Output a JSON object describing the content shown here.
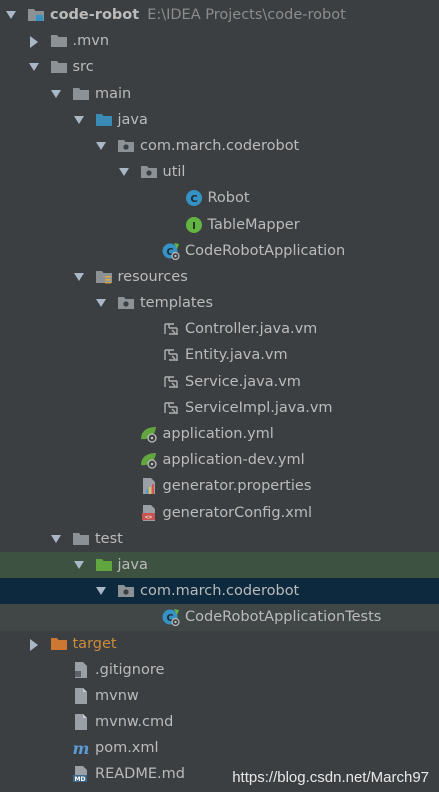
{
  "project": {
    "name": "code-robot",
    "path": "E:\\IDEA Projects\\code-robot"
  },
  "tree": [
    {
      "label": "code-robot",
      "extra": "E:\\IDEA Projects\\code-robot",
      "level": 0,
      "arrow": "down",
      "icon": "module-folder-icon",
      "name": "tree-item-code-robot"
    },
    {
      "label": ".mvn",
      "level": 1,
      "arrow": "right",
      "icon": "folder-icon",
      "name": "tree-item-mvn"
    },
    {
      "label": "src",
      "level": 1,
      "arrow": "down",
      "icon": "folder-icon",
      "name": "tree-item-src"
    },
    {
      "label": "main",
      "level": 2,
      "arrow": "down",
      "icon": "folder-icon",
      "name": "tree-item-main"
    },
    {
      "label": "java",
      "level": 3,
      "arrow": "down",
      "icon": "source-folder-icon",
      "name": "tree-item-main-java"
    },
    {
      "label": "com.march.coderobot",
      "level": 4,
      "arrow": "down",
      "icon": "package-icon",
      "name": "tree-item-package-main"
    },
    {
      "label": "util",
      "level": 5,
      "arrow": "down",
      "icon": "package-icon",
      "name": "tree-item-util"
    },
    {
      "label": "Robot",
      "level": 7,
      "arrow": "none",
      "icon": "class-icon",
      "name": "tree-item-robot"
    },
    {
      "label": "TableMapper",
      "level": 7,
      "arrow": "none",
      "icon": "interface-icon",
      "name": "tree-item-tablemapper"
    },
    {
      "label": "CodeRobotApplication",
      "level": 6,
      "arrow": "none",
      "icon": "spring-class-icon",
      "name": "tree-item-coderobotapplication"
    },
    {
      "label": "resources",
      "level": 3,
      "arrow": "down",
      "icon": "resources-folder-icon",
      "name": "tree-item-resources"
    },
    {
      "label": "templates",
      "level": 4,
      "arrow": "down",
      "icon": "package-icon",
      "name": "tree-item-templates"
    },
    {
      "label": "Controller.java.vm",
      "level": 6,
      "arrow": "none",
      "icon": "velocity-file-icon",
      "name": "tree-item-controller-vm"
    },
    {
      "label": "Entity.java.vm",
      "level": 6,
      "arrow": "none",
      "icon": "velocity-file-icon",
      "name": "tree-item-entity-vm"
    },
    {
      "label": "Service.java.vm",
      "level": 6,
      "arrow": "none",
      "icon": "velocity-file-icon",
      "name": "tree-item-service-vm"
    },
    {
      "label": "ServiceImpl.java.vm",
      "level": 6,
      "arrow": "none",
      "icon": "velocity-file-icon",
      "name": "tree-item-serviceimpl-vm"
    },
    {
      "label": "application.yml",
      "level": 5,
      "arrow": "none",
      "icon": "spring-config-icon",
      "name": "tree-item-application-yml"
    },
    {
      "label": "application-dev.yml",
      "level": 5,
      "arrow": "none",
      "icon": "spring-config-icon",
      "name": "tree-item-application-dev-yml"
    },
    {
      "label": "generator.properties",
      "level": 5,
      "arrow": "none",
      "icon": "properties-file-icon",
      "name": "tree-item-generator-properties"
    },
    {
      "label": "generatorConfig.xml",
      "level": 5,
      "arrow": "none",
      "icon": "xml-file-icon",
      "name": "tree-item-generatorconfig-xml"
    },
    {
      "label": "test",
      "level": 2,
      "arrow": "down",
      "icon": "folder-icon",
      "name": "tree-item-test"
    },
    {
      "label": "java",
      "level": 3,
      "arrow": "down",
      "icon": "test-folder-icon",
      "name": "tree-item-test-java",
      "highlight": "green"
    },
    {
      "label": "com.march.coderobot",
      "level": 4,
      "arrow": "down",
      "icon": "package-icon",
      "name": "tree-item-package-test",
      "highlight": "blue"
    },
    {
      "label": "CodeRobotApplicationTests",
      "level": 6,
      "arrow": "none",
      "icon": "spring-class-icon",
      "name": "tree-item-coderobotapplicationtests",
      "highlight": "light"
    },
    {
      "label": "target",
      "level": 1,
      "arrow": "right",
      "icon": "excluded-folder-icon",
      "name": "tree-item-target",
      "style": "target"
    },
    {
      "label": ".gitignore",
      "level": 2,
      "arrow": "none",
      "icon": "gitignore-file-icon",
      "name": "tree-item-gitignore"
    },
    {
      "label": "mvnw",
      "level": 2,
      "arrow": "none",
      "icon": "text-file-icon",
      "name": "tree-item-mvnw"
    },
    {
      "label": "mvnw.cmd",
      "level": 2,
      "arrow": "none",
      "icon": "text-file-icon",
      "name": "tree-item-mvnw-cmd"
    },
    {
      "label": "pom.xml",
      "level": 2,
      "arrow": "none",
      "icon": "maven-icon",
      "name": "tree-item-pom-xml"
    },
    {
      "label": "README.md",
      "level": 2,
      "arrow": "none",
      "icon": "markdown-file-icon",
      "name": "tree-item-readme-md"
    }
  ],
  "watermark": "https://blog.csdn.net/March97",
  "colors": {
    "background": "#3c3f41",
    "text": "#bbbbbb",
    "selection_blue": "#0d293e",
    "highlight_green": "#3e5241",
    "excluded": "#cc8c3c"
  }
}
